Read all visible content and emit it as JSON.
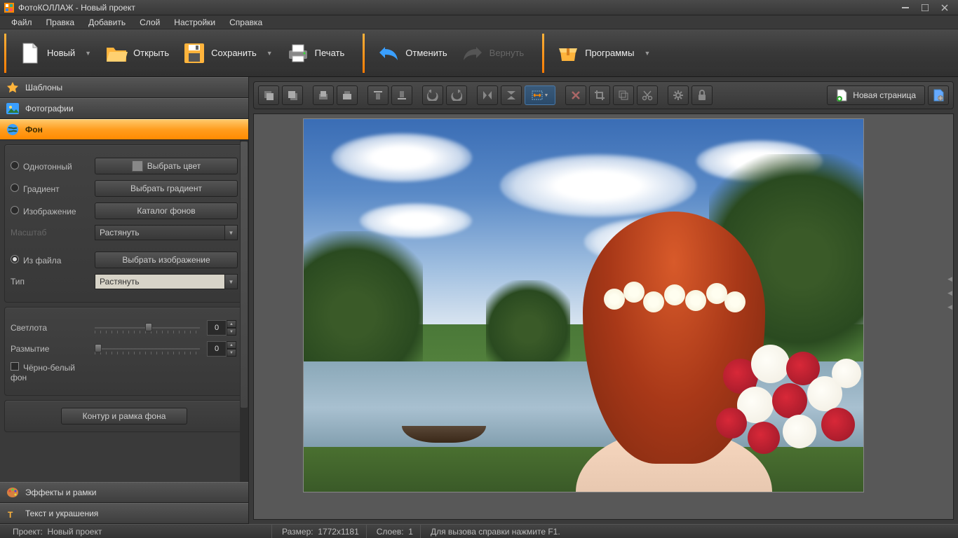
{
  "title": "ФотоКОЛЛАЖ - Новый проект",
  "menu": [
    "Файл",
    "Правка",
    "Добавить",
    "Слой",
    "Настройки",
    "Справка"
  ],
  "toolbar": {
    "new": "Новый",
    "open": "Открыть",
    "save": "Сохранить",
    "print": "Печать",
    "undo": "Отменить",
    "redo": "Вернуть",
    "programs": "Программы"
  },
  "accordion": {
    "templates": "Шаблоны",
    "photos": "Фотографии",
    "background": "Фон",
    "effects": "Эффекты и рамки",
    "text": "Текст и украшения"
  },
  "bg_panel": {
    "solid": "Однотонный",
    "pick_color": "Выбрать цвет",
    "gradient": "Градиент",
    "pick_gradient": "Выбрать градиент",
    "image": "Изображение",
    "catalog": "Каталог фонов",
    "scale": "Масштаб",
    "scale_val": "Растянуть",
    "from_file": "Из файла",
    "pick_image": "Выбрать изображение",
    "type": "Тип",
    "type_val": "Растянуть",
    "brightness": "Светлота",
    "brightness_val": "0",
    "blur": "Размытие",
    "blur_val": "0",
    "bw": "Чёрно-белый фон",
    "outline": "Контур и рамка фона"
  },
  "sectoolbar": {
    "newpage": "Новая страница"
  },
  "status": {
    "project_lbl": "Проект:",
    "project_val": "Новый проект",
    "size_lbl": "Размер:",
    "size_val": "1772x1181",
    "layers_lbl": "Слоев:",
    "layers_val": "1",
    "help": "Для вызова справки нажмите F1."
  }
}
